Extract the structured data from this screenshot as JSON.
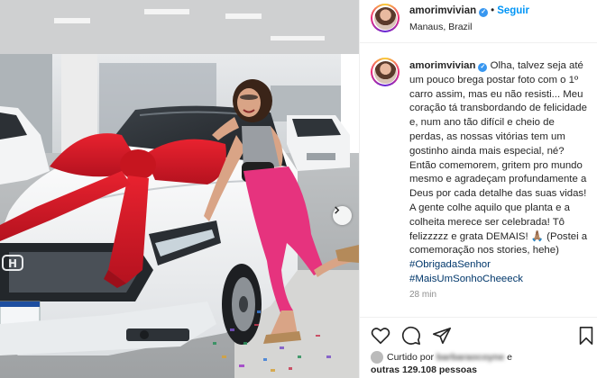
{
  "post": {
    "username": "amorimvivian",
    "follow_label": "Seguir",
    "location": "Manaus, Brazil",
    "caption_username": "amorimvivian",
    "caption_text": "Olha, talvez seja até um pouco brega postar foto com o 1º carro assim, mas eu não resisti... Meu coração tá transbordando de felicidade e, num ano tão difícil e cheio de perdas, as nossas vitórias tem um gostinho ainda mais especial, né? Então comemorem, gritem pro mundo mesmo e agradeçam profundamente a Deus por cada detalhe das suas vidas! A gente colhe aquilo que planta e a colheita merece ser celebrada! Tô felizzzzz e grata DEMAIS! 🙏🏽 (Postei a comemoração nos stories, hehe)",
    "hashtag1": "#ObrigadaSenhor",
    "hashtag2": "#MaisUmSonhoCheeeck",
    "time_ago": "28 min",
    "liked_by_prefix": "Curtido por",
    "liked_by_user": "barbaraocoyne",
    "liked_by_connector": "e",
    "liked_by_others": "outras 129.108 pessoas"
  },
  "icons": {
    "verified": "verified-badge-icon",
    "like": "heart-icon",
    "comment": "comment-icon",
    "share": "paper-plane-icon",
    "save": "bookmark-icon",
    "next": "chevron-right-icon"
  },
  "colors": {
    "accent": "#0095f6",
    "hashtag": "#00376b",
    "verified": "#3897f0",
    "ribbon": "#d21a2a",
    "muted": "#8e8e8e"
  }
}
